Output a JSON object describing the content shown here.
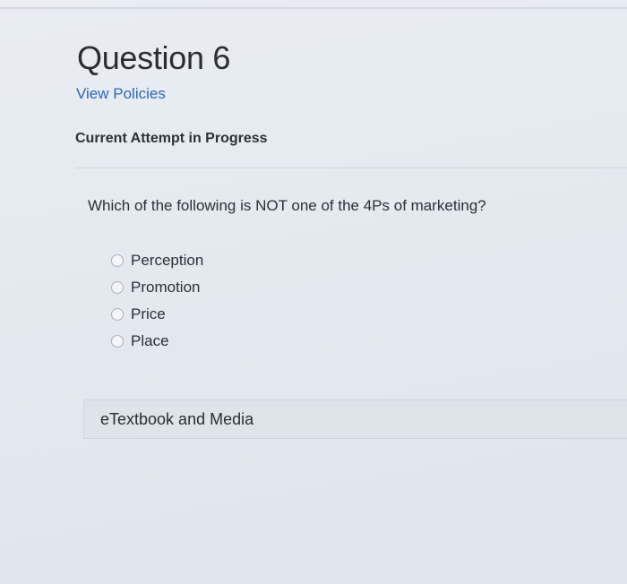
{
  "question": {
    "title": "Question 6",
    "policies_link": "View Policies",
    "attempt_status": "Current Attempt in Progress",
    "prompt": "Which of the following is NOT one of the 4Ps of marketing?",
    "options": [
      {
        "label": "Perception"
      },
      {
        "label": "Promotion"
      },
      {
        "label": "Price"
      },
      {
        "label": "Place"
      }
    ]
  },
  "resources": {
    "etextbook_label": "eTextbook and Media"
  },
  "icons": {
    "radio": "radio-unchecked-icon"
  }
}
